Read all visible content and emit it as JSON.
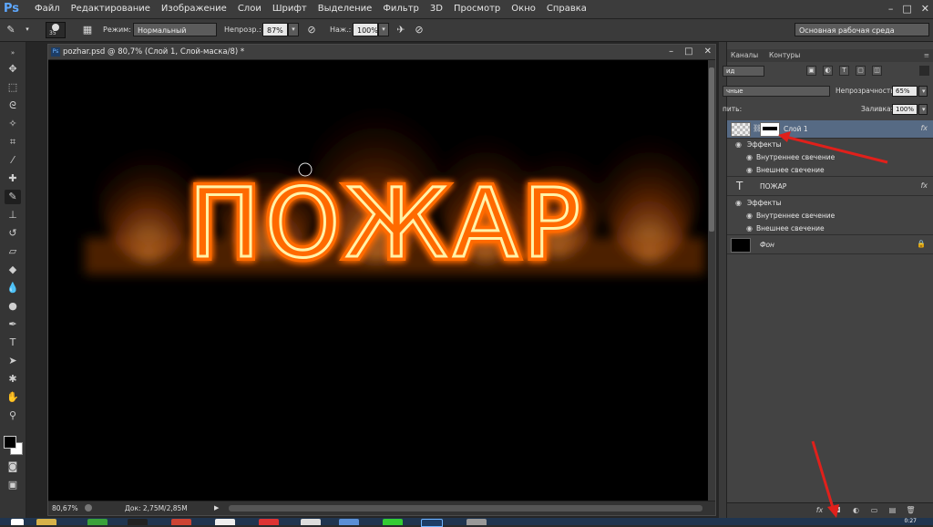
{
  "app": {
    "logo": "Ps",
    "menu": [
      "Файл",
      "Редактирование",
      "Изображение",
      "Слои",
      "Шрифт",
      "Выделение",
      "Фильтр",
      "3D",
      "Просмотр",
      "Окно",
      "Справка"
    ],
    "window_controls": [
      "–",
      "□",
      "✕"
    ]
  },
  "options_bar": {
    "brush_size": "35",
    "mode_label": "Режим:",
    "mode_value": "Нормальный",
    "opacity_label": "Непрозр.:",
    "opacity_value": "87%",
    "flow_label": "Наж.:",
    "flow_value": "100%",
    "workspace": "Основная рабочая среда"
  },
  "document": {
    "title": "pozhar.psd @ 80,7% (Слой 1, Слой-маска/8) *",
    "icon_label": "Ps",
    "canvas_text": "ПОЖАР",
    "zoom": "80,67%",
    "doc_size": "Док: 2,75M/2,85M",
    "controls": [
      "–",
      "□",
      "✕"
    ]
  },
  "panels": {
    "tabs": [
      "Каналы",
      "Контуры"
    ],
    "kind_filter": "ид",
    "blend_mode": "чные",
    "opacity_label": "Непрозрачность:",
    "opacity_value": "65%",
    "lock_label": "пить:",
    "fill_label": "Заливка:",
    "fill_value": "100%"
  },
  "layers": [
    {
      "name": "Слой 1",
      "fx": "fx",
      "selected": true
    },
    {
      "name": "Эффекты"
    },
    {
      "name": "Внутреннее свечение"
    },
    {
      "name": "Внешнее свечение"
    },
    {
      "name": "ПОЖАР",
      "type_icon": "T",
      "fx": "fx"
    },
    {
      "name": "Эффекты"
    },
    {
      "name": "Внутреннее свечение"
    },
    {
      "name": "Внешнее свечение"
    },
    {
      "name": "Фон",
      "lock": "🔒"
    }
  ],
  "taskbar": {
    "clock": "0:27"
  },
  "colors": {
    "accent": "#5ea8ff",
    "selected_layer": "#566a84",
    "arrow": "#e0201b",
    "fire_core": "#fff2a8",
    "fire_outer": "#ff6a00"
  }
}
